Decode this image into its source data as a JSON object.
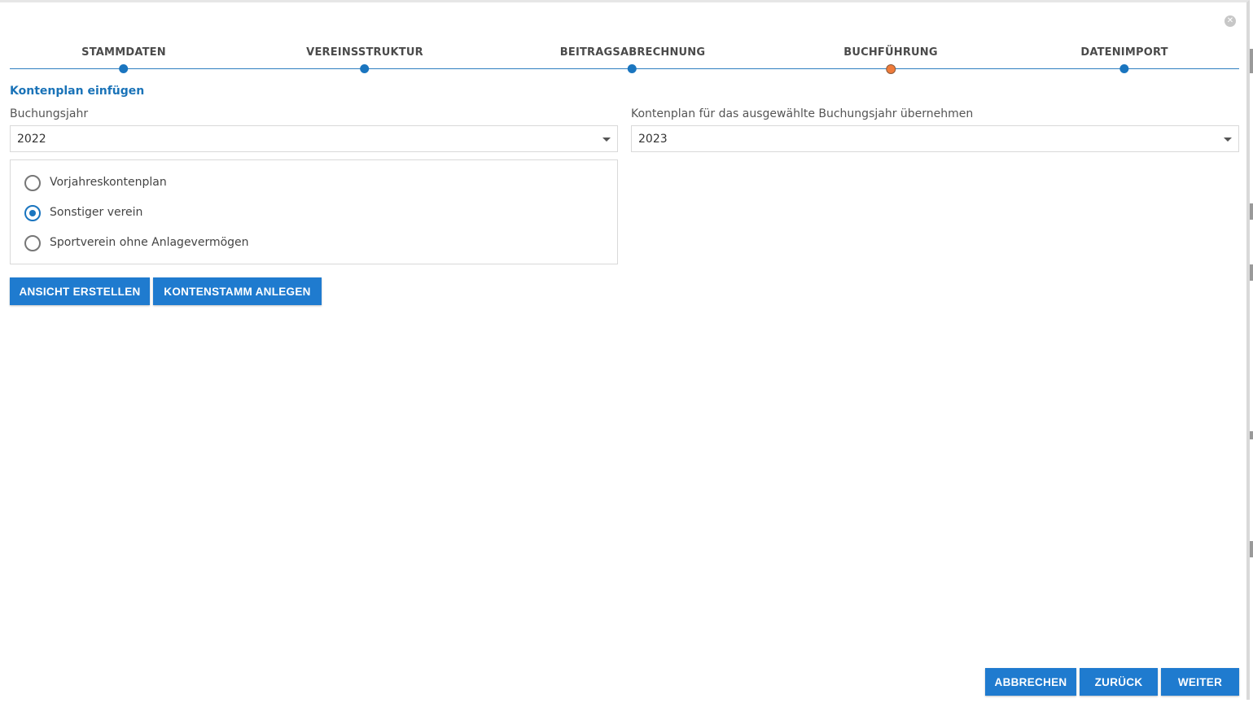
{
  "dialog": {
    "close_icon": "close-circle-icon",
    "close_glyph": "✕"
  },
  "stepper": {
    "steps": [
      {
        "label": "STAMMDATEN",
        "state": "done"
      },
      {
        "label": "VEREINSSTRUKTUR",
        "state": "done"
      },
      {
        "label": "BEITRAGSABRECHNUNG",
        "state": "done"
      },
      {
        "label": "BUCHFÜHRUNG",
        "state": "active"
      },
      {
        "label": "DATENIMPORT",
        "state": "pending"
      }
    ],
    "colors": {
      "line": "#2e7fc0",
      "dot": "#1a75bf",
      "active_dot": "#ef7b3a"
    }
  },
  "section": {
    "title": "Kontenplan einfügen"
  },
  "fields": {
    "buchungsjahr": {
      "label": "Buchungsjahr",
      "value": "2022"
    },
    "kontenplan_uebernehmen": {
      "label": "Kontenplan für das ausgewählte Buchungsjahr übernehmen",
      "value": "2023"
    }
  },
  "radio_options": [
    {
      "label": "Vorjahreskontenplan",
      "checked": false
    },
    {
      "label": "Sonstiger verein",
      "checked": true
    },
    {
      "label": "Sportverein ohne Anlagevermögen",
      "checked": false
    }
  ],
  "actions": {
    "ansicht_erstellen": "ANSICHT ERSTELLEN",
    "kontenstamm_anlegen": "KONTENSTAMM ANLEGEN"
  },
  "footer": {
    "abbrechen": "ABBRECHEN",
    "zurueck": "ZURÜCK",
    "weiter": "WEITER"
  },
  "colors": {
    "primary_button": "#1f7bcf",
    "section_title": "#1a73b8"
  }
}
